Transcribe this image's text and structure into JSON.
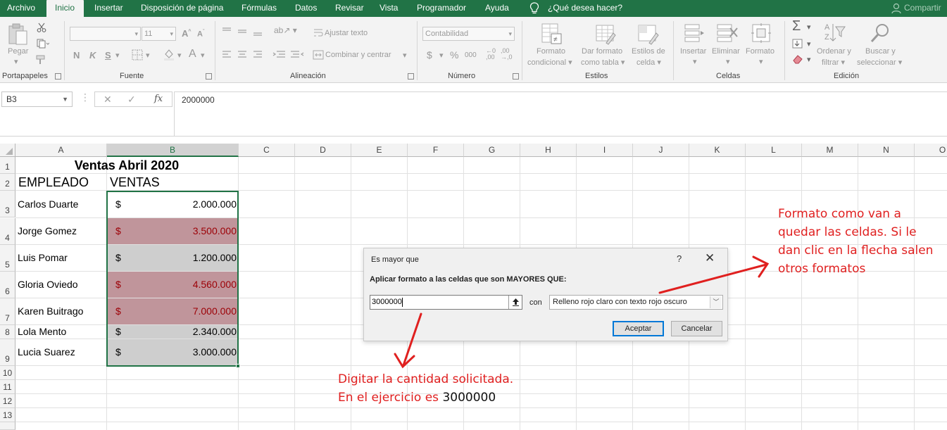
{
  "ribbon_tabs": [
    {
      "label": "Archivo"
    },
    {
      "label": "Inicio"
    },
    {
      "label": "Insertar"
    },
    {
      "label": "Disposición de página"
    },
    {
      "label": "Fórmulas"
    },
    {
      "label": "Datos"
    },
    {
      "label": "Revisar"
    },
    {
      "label": "Vista"
    },
    {
      "label": "Programador"
    },
    {
      "label": "Ayuda"
    }
  ],
  "active_tab": "Inicio",
  "tell_me": "¿Qué desea hacer?",
  "share": "Compartir",
  "ribbon": {
    "portapapeles": {
      "label": "Portapapeles",
      "paste": "Pegar"
    },
    "fuente": {
      "label": "Fuente",
      "size": "11",
      "bold": "N",
      "italic": "K",
      "underline": "S"
    },
    "alineacion": {
      "label": "Alineación",
      "wrap": "Ajustar texto",
      "merge": "Combinar y centrar"
    },
    "numero": {
      "label": "Número",
      "format": "Contabilidad",
      "currency": "$",
      "percent": "%",
      "thousands": "000",
      "inc_decimal": "⁰₀",
      "dec_decimal": "₀⁰"
    },
    "estilos": {
      "label": "Estilos",
      "cond_format_1": "Formato",
      "cond_format_2": "condicional",
      "table_format_1": "Dar formato",
      "table_format_2": "como tabla",
      "cell_styles_1": "Estilos de",
      "cell_styles_2": "celda"
    },
    "celdas": {
      "label": "Celdas",
      "insert": "Insertar",
      "delete": "Eliminar",
      "format": "Formato"
    },
    "edicion": {
      "label": "Edición",
      "sort_1": "Ordenar y",
      "sort_2": "filtrar",
      "find_1": "Buscar y",
      "find_2": "seleccionar"
    }
  },
  "formula_bar": {
    "name_box": "B3",
    "fx": "fx",
    "value": "2000000"
  },
  "columns": [
    "A",
    "B",
    "C",
    "D",
    "E",
    "F",
    "G",
    "H",
    "I",
    "J",
    "K",
    "L",
    "M",
    "N",
    "O"
  ],
  "rows": [
    "1",
    "2",
    "3",
    "4",
    "5",
    "6",
    "7",
    "8",
    "9",
    "10",
    "11",
    "12",
    "13"
  ],
  "sheet": {
    "title": "Ventas Abril 2020",
    "header_employee": "EMPLEADO",
    "header_sales": "VENTAS",
    "currency": "$",
    "records": [
      {
        "name": "Carlos Duarte",
        "amount": "2.000.000",
        "highlight": false
      },
      {
        "name": "Jorge Gomez",
        "amount": "3.500.000",
        "highlight": true
      },
      {
        "name": "Luis Pomar",
        "amount": "1.200.000",
        "highlight": false
      },
      {
        "name": "Gloria Oviedo",
        "amount": "4.560.000",
        "highlight": true
      },
      {
        "name": "Karen Buitrago",
        "amount": "7.000.000",
        "highlight": true
      },
      {
        "name": "Lola Mento",
        "amount": "2.340.000",
        "highlight": false
      },
      {
        "name": "Lucia Suarez",
        "amount": "3.000.000",
        "highlight": false
      }
    ]
  },
  "dialog": {
    "title": "Es mayor que",
    "help": "?",
    "close": "✕",
    "prompt": "Aplicar formato a las celdas que son MAYORES QUE:",
    "input_value": "3000000",
    "connector": "con",
    "format_option": "Relleno rojo claro con texto rojo oscuro",
    "ok": "Aceptar",
    "cancel": "Cancelar"
  },
  "annotations": {
    "right_lines": [
      "Formato como van a",
      "quedar las celdas. Si le",
      "dan clic en la flecha salen",
      "otros formatos"
    ],
    "bottom_line1": "Digitar la cantidad solicitada.",
    "bottom_line2_red": "En el ejercicio es ",
    "bottom_line2_black": "3000000"
  },
  "colors": {
    "excel_green": "#217346",
    "highlight_fill": "#c0959b",
    "highlight_text": "#9c0006",
    "gray_fill": "#cecece",
    "annotation_red": "#e02020"
  }
}
